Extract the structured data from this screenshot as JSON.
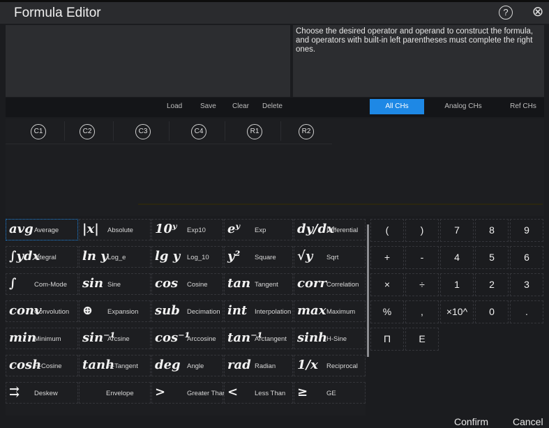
{
  "window": {
    "title": "Formula Editor",
    "help_icon": "?",
    "close_icon": "⊗"
  },
  "help_text": "Choose the desired operator and operand to construct the formula, and operators with built-in left parentheses must complete the right ones.",
  "toolbar": {
    "load": "Load",
    "save": "Save",
    "clear": "Clear",
    "delete": "Delete"
  },
  "tabs": [
    "All CHs",
    "Analog CHs",
    "Ref CHs"
  ],
  "channels": [
    "C1",
    "C2",
    "C3",
    "C4",
    "R1",
    "R2"
  ],
  "operators": [
    [
      {
        "sym": "avg",
        "label": "Average"
      },
      {
        "sym": "|x|",
        "label": "Absolute"
      },
      {
        "sym": "10ʸ",
        "label": "Exp10"
      },
      {
        "sym": "eʸ",
        "label": "Exp"
      },
      {
        "sym": "dy/dx",
        "label": "Differential"
      }
    ],
    [
      {
        "sym": "∫ydx",
        "label": "Integral"
      },
      {
        "sym": "ln y",
        "label": "Log_e"
      },
      {
        "sym": "lg y",
        "label": "Log_10"
      },
      {
        "sym": "y²",
        "label": "Square"
      },
      {
        "sym": "√y",
        "label": "Sqrt"
      }
    ],
    [
      {
        "sym": "∫",
        "label": "Com-Mode"
      },
      {
        "sym": "sin",
        "label": "Sine"
      },
      {
        "sym": "cos",
        "label": "Cosine"
      },
      {
        "sym": "tan",
        "label": "Tangent"
      },
      {
        "sym": "corr",
        "label": "Correlation"
      }
    ],
    [
      {
        "sym": "conv",
        "label": "Convolution"
      },
      {
        "sym": "⊕",
        "label": "Expansion"
      },
      {
        "sym": "sub",
        "label": "Decimation"
      },
      {
        "sym": "int",
        "label": "Interpolation"
      },
      {
        "sym": "max",
        "label": "Maximum"
      }
    ],
    [
      {
        "sym": "min",
        "label": "Minimum"
      },
      {
        "sym": "sin⁻¹",
        "label": "Arcsine"
      },
      {
        "sym": "cos⁻¹",
        "label": "Arccosine"
      },
      {
        "sym": "tan⁻¹",
        "label": "Arctangent"
      },
      {
        "sym": "sinh",
        "label": "H-Sine"
      }
    ],
    [
      {
        "sym": "cosh",
        "label": "H-Cosine"
      },
      {
        "sym": "tanh",
        "label": "H-Tangent"
      },
      {
        "sym": "deg",
        "label": "Angle"
      },
      {
        "sym": "rad",
        "label": "Radian"
      },
      {
        "sym": "1/x",
        "label": "Reciprocal"
      }
    ],
    [
      {
        "sym": "⇉",
        "label": "Deskew"
      },
      {
        "sym": "",
        "label": "Envelope"
      },
      {
        "sym": ">",
        "label": "Greater Thar"
      },
      {
        "sym": "<",
        "label": "Less Than"
      },
      {
        "sym": "≥",
        "label": "GE"
      }
    ]
  ],
  "keypad": [
    [
      "(",
      ")",
      "7",
      "8",
      "9"
    ],
    [
      "+",
      "-",
      "4",
      "5",
      "6"
    ],
    [
      "×",
      "÷",
      "1",
      "2",
      "3"
    ],
    [
      "%",
      ",",
      "×10^",
      "0",
      "."
    ],
    [
      "Π",
      "E",
      "",
      "",
      ""
    ]
  ],
  "footer": {
    "confirm": "Confirm",
    "cancel": "Cancel"
  }
}
